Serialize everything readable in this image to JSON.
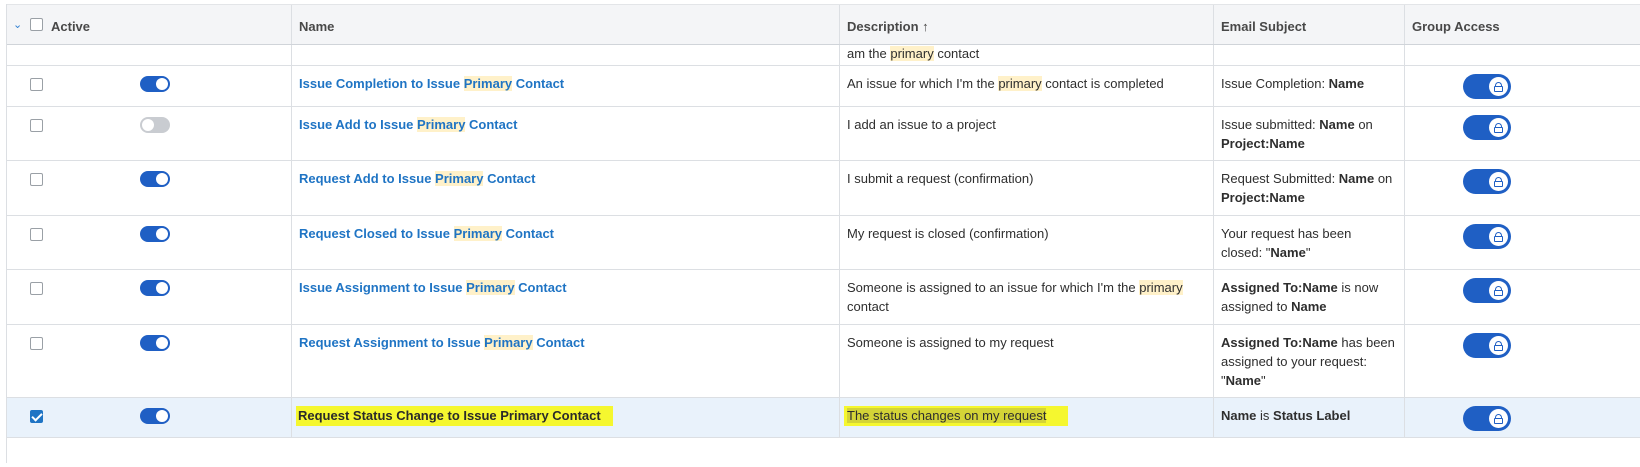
{
  "columns": {
    "active": "Active",
    "name": "Name",
    "description": "Description",
    "sort_arrow": "↑",
    "email_subject": "Email Subject",
    "group_access": "Group Access"
  },
  "partial_row": {
    "description_tail_pre": "am the ",
    "description_tail_hl": "primary",
    "description_tail_post": " contact"
  },
  "rows": [
    {
      "checked": false,
      "active": true,
      "name": [
        "Issue Completion to Issue ",
        "Primary",
        " Contact"
      ],
      "description": [
        "An issue for which I'm the ",
        "primary",
        " contact is completed"
      ],
      "subject": [
        [
          "Issue Completion: ",
          false
        ],
        [
          "Name",
          true
        ]
      ]
    },
    {
      "checked": false,
      "active": false,
      "name": [
        "Issue Add to Issue ",
        "Primary",
        " Contact"
      ],
      "description": [
        "I add an issue to a project",
        "",
        ""
      ],
      "subject": [
        [
          "Issue submitted: ",
          false
        ],
        [
          "Name",
          true
        ],
        [
          " on ",
          false
        ],
        [
          "Project:Name",
          true
        ]
      ]
    },
    {
      "checked": false,
      "active": true,
      "name": [
        "Request Add to Issue ",
        "Primary",
        " Contact"
      ],
      "description": [
        "I submit a request (confirmation)",
        "",
        ""
      ],
      "subject": [
        [
          "Request Submitted: ",
          false
        ],
        [
          "Name",
          true
        ],
        [
          " on ",
          false
        ],
        [
          "Project:Name",
          true
        ]
      ]
    },
    {
      "checked": false,
      "active": true,
      "name": [
        "Request Closed to Issue ",
        "Primary",
        " Contact"
      ],
      "description": [
        "My request is closed (confirmation)",
        "",
        ""
      ],
      "subject": [
        [
          "Your request has been closed: \"",
          false
        ],
        [
          "Name",
          true
        ],
        [
          "\"",
          false
        ]
      ]
    },
    {
      "checked": false,
      "active": true,
      "name": [
        "Issue Assignment to Issue ",
        "Primary",
        " Contact"
      ],
      "description": [
        "Someone is assigned to an issue for which I'm the ",
        "primary",
        " contact"
      ],
      "subject": [
        [
          "Assigned To:Name",
          true
        ],
        [
          " is now assigned to ",
          false
        ],
        [
          "Name",
          true
        ]
      ]
    },
    {
      "checked": false,
      "active": true,
      "name": [
        "Request Assignment to Issue ",
        "Primary",
        " Contact"
      ],
      "description": [
        "Someone is assigned to my request",
        "",
        ""
      ],
      "subject": [
        [
          "Assigned To:Name",
          true
        ],
        [
          " has been assigned to your request: \"",
          false
        ],
        [
          "Name",
          true
        ],
        [
          "\"",
          false
        ]
      ]
    },
    {
      "checked": true,
      "active": true,
      "name": [
        "Request Status Change to Issue Primary Contact",
        "",
        ""
      ],
      "description": [
        "The status changes on my request",
        "",
        ""
      ],
      "subject": [
        [
          "Name",
          true
        ],
        [
          " is ",
          false
        ],
        [
          "Status Label",
          true
        ]
      ]
    }
  ]
}
